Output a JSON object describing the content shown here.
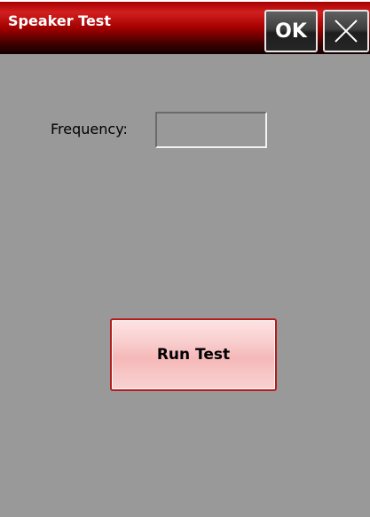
{
  "window": {
    "title": "Speaker Test",
    "ok_label": "OK",
    "close_icon": "close-x-icon"
  },
  "form": {
    "frequency_label": "Frequency:",
    "frequency_value": ""
  },
  "actions": {
    "run_test_label": "Run Test"
  },
  "colors": {
    "titlebar_red": "#a30000",
    "background_gray": "#999999",
    "button_pink": "#f5b8b8",
    "button_border_red": "#b51d1d"
  }
}
